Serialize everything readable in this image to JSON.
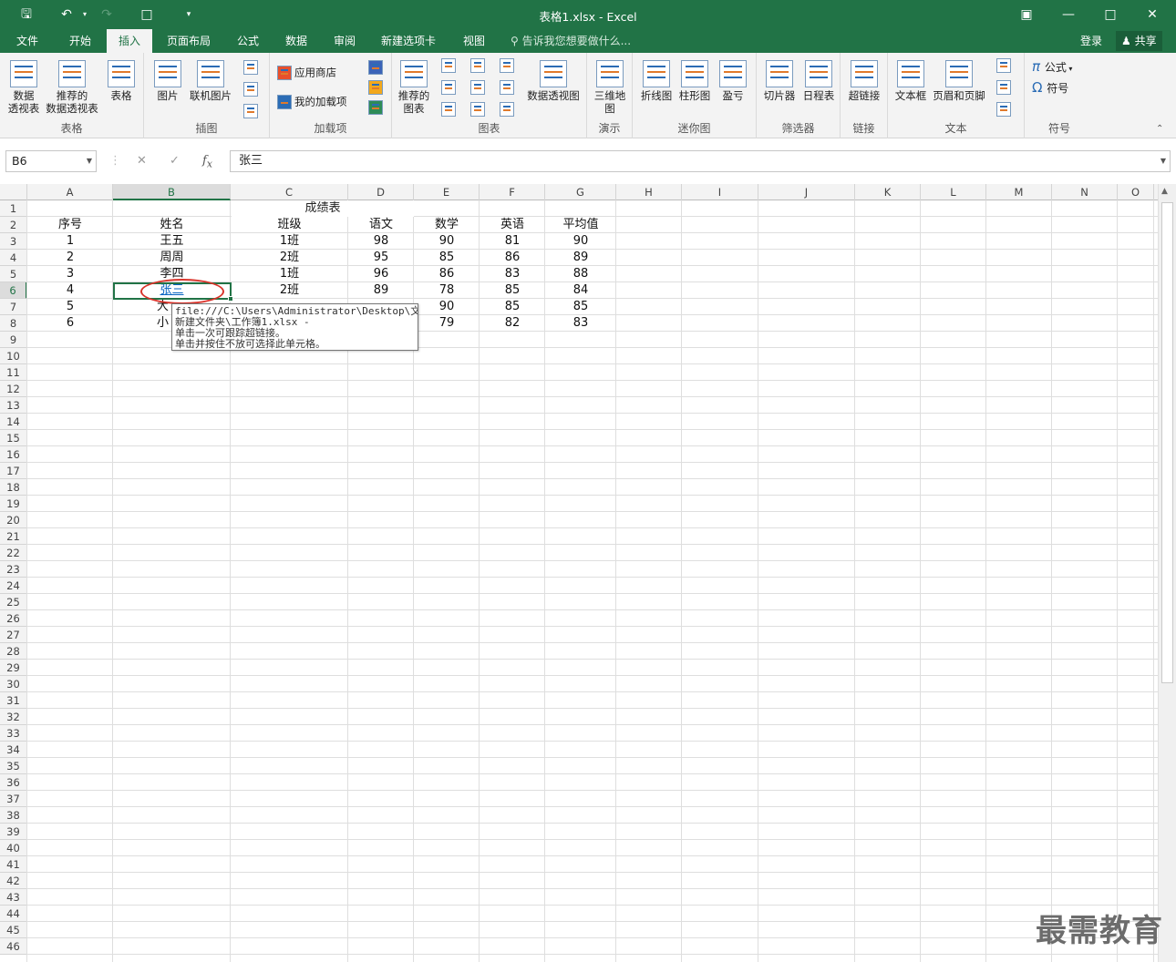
{
  "window": {
    "title": "表格1.xlsx - Excel",
    "icons": [
      "save-icon",
      "undo-icon",
      "redo-icon",
      "new-file-icon",
      "customize-icon"
    ],
    "controls": [
      "restore-ribbon-icon",
      "minimize-icon",
      "maximize-icon",
      "close-icon"
    ]
  },
  "tabs": [
    "文件",
    "开始",
    "插入",
    "页面布局",
    "公式",
    "数据",
    "审阅",
    "新建选项卡",
    "视图"
  ],
  "active_tab": "插入",
  "tellme": "告诉我您想要做什么...",
  "login": "登录",
  "share": "共享",
  "ribbon": {
    "groups": {
      "tables": "表格",
      "illustrations": "插图",
      "addins": "加载项",
      "charts": "图表",
      "tours": "演示",
      "sparklines": "迷你图",
      "filters": "筛选器",
      "links": "链接",
      "text": "文本",
      "symbols": "符号"
    },
    "btn": {
      "pivot1": "数据",
      "pivot2": "透视表",
      "recpivot1": "推荐的",
      "recpivot2": "数据透视表",
      "table": "表格",
      "pictures": "图片",
      "online_pictures": "联机图片",
      "store": "应用商店",
      "myaddins": "我的加载项",
      "recchart1": "推荐的",
      "recchart2": "图表",
      "pivotchart": "数据透视图",
      "map3d1": "三维地",
      "map3d2": "图",
      "line": "折线图",
      "column": "柱形图",
      "winloss": "盈亏",
      "slicer": "切片器",
      "timeline": "日程表",
      "hyperlink": "超链接",
      "textbox": "文本框",
      "headerfooter": "页眉和页脚",
      "equation": "公式",
      "symbol": "符号"
    }
  },
  "namebox": "B6",
  "formula": "张三",
  "formula_buttons": [
    "cancel-icon",
    "enter-icon",
    "fx-icon"
  ],
  "columns": [
    "A",
    "B",
    "C",
    "D",
    "E",
    "F",
    "G",
    "H",
    "I",
    "J",
    "K",
    "L",
    "M",
    "N",
    "O"
  ],
  "selected_column": "B",
  "selected_row": 6,
  "sheet": {
    "title": "成绩表",
    "headers": [
      "序号",
      "姓名",
      "班级",
      "语文",
      "数学",
      "英语",
      "平均值"
    ],
    "rows": [
      [
        "1",
        "王五",
        "1班",
        "98",
        "90",
        "81",
        "90"
      ],
      [
        "2",
        "周周",
        "2班",
        "95",
        "85",
        "86",
        "89"
      ],
      [
        "3",
        "李四",
        "1班",
        "96",
        "86",
        "83",
        "88"
      ],
      [
        "4",
        "张三",
        "2班",
        "89",
        "78",
        "85",
        "84"
      ],
      [
        "5",
        "大",
        "",
        "",
        "90",
        "85",
        "85"
      ],
      [
        "6",
        "小",
        "",
        "",
        "79",
        "82",
        "83"
      ]
    ]
  },
  "tooltip": [
    "file:///C:\\Users\\Administrator\\Desktop\\文件\\",
    "新建文件夹\\工作簿1.xlsx -",
    "单击一次可跟踪超链接。",
    "单击并按住不放可选择此单元格。"
  ],
  "watermark": "最需教育",
  "colors": {
    "excel_green": "#217346",
    "hyperlink": "#0563c1",
    "annotation_red": "#d9342b"
  }
}
